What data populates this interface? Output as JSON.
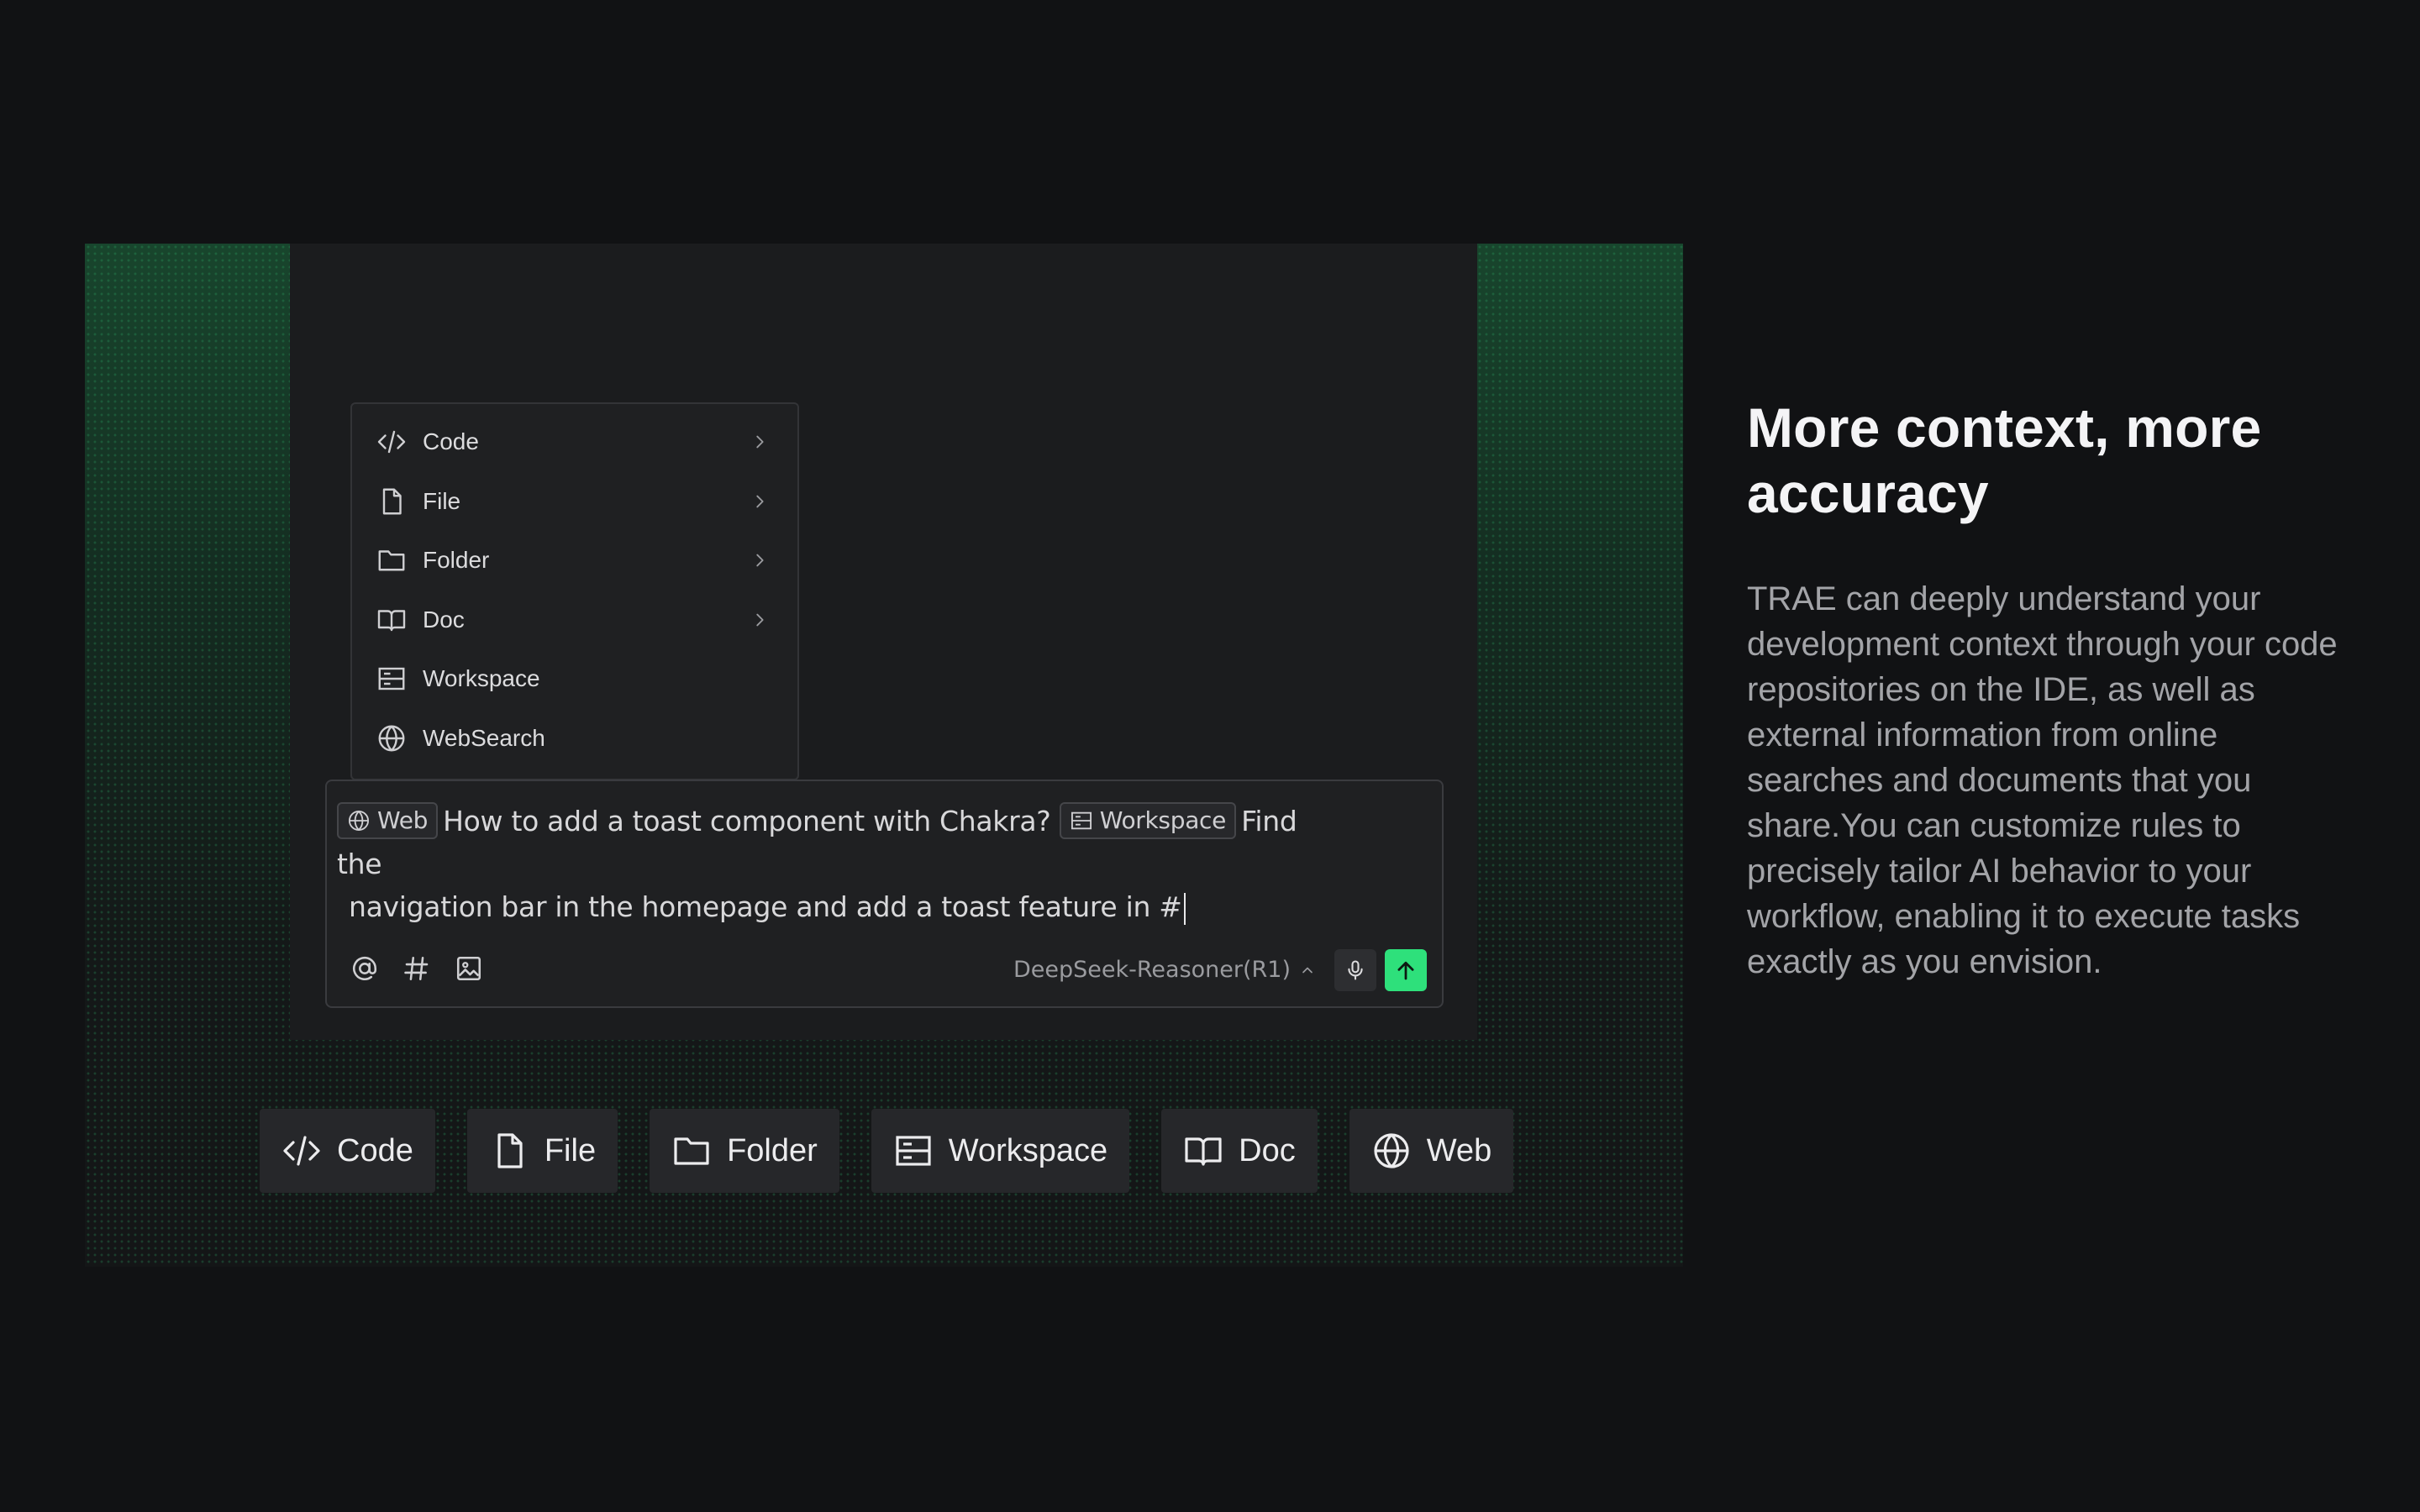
{
  "menu": {
    "items": [
      {
        "label": "Code",
        "icon": "code-icon",
        "has_submenu": true
      },
      {
        "label": "File",
        "icon": "file-icon",
        "has_submenu": true
      },
      {
        "label": "Folder",
        "icon": "folder-icon",
        "has_submenu": true
      },
      {
        "label": "Doc",
        "icon": "book-icon",
        "has_submenu": true
      },
      {
        "label": "Workspace",
        "icon": "workspace-icon",
        "has_submenu": false
      },
      {
        "label": "WebSearch",
        "icon": "globe-icon",
        "has_submenu": false
      }
    ]
  },
  "composer": {
    "chip_web": "Web",
    "text_part1": "How to add a toast component with Chakra?",
    "chip_workspace": "Workspace",
    "text_part2": "Find the",
    "text_line2": "navigation bar in the homepage and add a toast feature in #",
    "model": "DeepSeek-Reasoner(R1)",
    "tools": [
      "at-icon",
      "hash-icon",
      "image-icon"
    ]
  },
  "pills": [
    {
      "label": "Code",
      "icon": "code-icon"
    },
    {
      "label": "File",
      "icon": "file-icon"
    },
    {
      "label": "Folder",
      "icon": "folder-icon"
    },
    {
      "label": "Workspace",
      "icon": "workspace-icon"
    },
    {
      "label": "Doc",
      "icon": "book-icon"
    },
    {
      "label": "Web",
      "icon": "globe-icon"
    }
  ],
  "side": {
    "title": "More context, more accuracy",
    "body": "TRAE can deeply understand your development context through your code repositories on the IDE, as well as external information from online searches and documents that you share.You can customize rules to precisely tailor AI behavior to your workflow, enabling it to execute tasks exactly as you envision."
  },
  "colors": {
    "background": "#111214",
    "panel": "#1b1c1e",
    "accent_green": "#2ee07b",
    "text_muted": "#a3a4a8"
  }
}
